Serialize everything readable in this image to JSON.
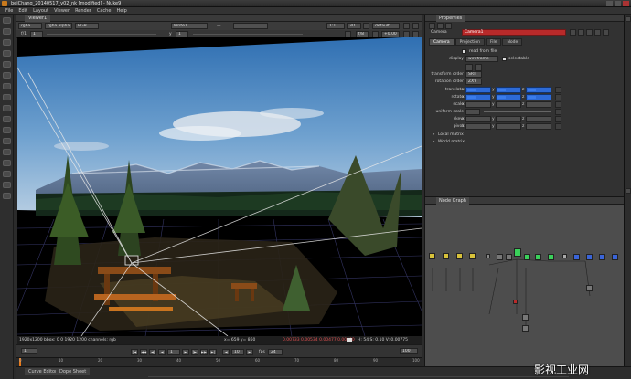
{
  "window": {
    "title": "beiChang_20140517_v02_nk [modified] - Nuke9"
  },
  "menubar": [
    "File",
    "Edit",
    "Layout",
    "Viewer",
    "Render",
    "Cache",
    "Help"
  ],
  "viewer": {
    "tab_label": "Viewer1",
    "channels": "rgba",
    "layer": "rgba.alpha",
    "colorspace": "RGB",
    "input_a": "Write1",
    "input_b": "",
    "zoom": "1:1",
    "gain_label": "f/1",
    "gamma_label": "y",
    "view_mode": "3D",
    "camera_mode": "default",
    "frame_label": "f/8",
    "exposure": "+0.00",
    "format_info": "1920x1200 bbox: 0 0 1920 1200 channels: rgb",
    "coords": "x= 659 y= 860",
    "pixel_values": "0.00733  0.00534  0.00477  0.00000",
    "hsv_readout": "H: 54 S: 0.10 V: 0.00775"
  },
  "timeline": {
    "fps_label": "fps",
    "fps_value": "24",
    "current_frame": "1",
    "range_start": "1",
    "range_end": "100",
    "increment": "10",
    "scope": "Global",
    "ruler_marks": [
      "0",
      "10",
      "20",
      "30",
      "40",
      "50",
      "60",
      "70",
      "80",
      "90",
      "100"
    ]
  },
  "bottom_tabs": [
    "Curve Editor",
    "Dope Sheet"
  ],
  "properties": {
    "panel_label": "Properties",
    "node_class": "Camera",
    "node_name": "Camera1",
    "tabs": [
      "Camera",
      "Projection",
      "File",
      "Node"
    ],
    "read_from_file_label": "read from file",
    "display_label": "display",
    "display_value": "wireframe",
    "selectable_label": "selectable",
    "transform_order_label": "transform order",
    "transform_order_value": "SRT",
    "rotation_order_label": "rotation order",
    "rotation_order_value": "ZXY",
    "translate_label": "translate",
    "rotate_label": "rotate",
    "scale_label": "scale",
    "uniform_scale_label": "uniform scale",
    "skew_label": "skew",
    "pivot_label": "pivot",
    "local_matrix_label": "Local matrix",
    "world_matrix_label": "World matrix",
    "axis_labels": [
      "x",
      "y",
      "z"
    ]
  },
  "nodegraph": {
    "panel_label": "Node Graph"
  },
  "watermark": "影视工业网",
  "colors": {
    "accent_orange": "#c97a1d",
    "selected_node_red": "#b82a2a",
    "keyed_blue": "#2d6ad6",
    "node_yellow": "#d8c23a",
    "node_green": "#3ad05a",
    "node_blue": "#3a64d8"
  }
}
